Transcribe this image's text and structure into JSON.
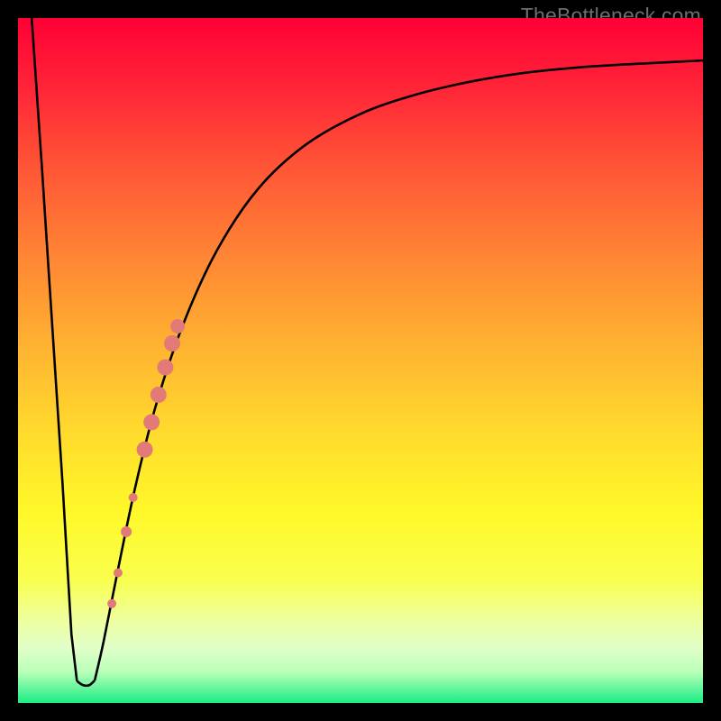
{
  "watermark": {
    "text": "TheBottleneck.com"
  },
  "colors": {
    "frame": "#000000",
    "curve": "#000000",
    "marker": "#e27b78",
    "marker_stroke": "#bb5a52"
  },
  "chart_data": {
    "type": "line",
    "title": "",
    "xlabel": "",
    "ylabel": "",
    "xlim": [
      0,
      100
    ],
    "ylim": [
      0,
      100
    ],
    "gradient_stops": [
      {
        "offset": 0.0,
        "color": "#ff0036"
      },
      {
        "offset": 0.1,
        "color": "#ff2437"
      },
      {
        "offset": 0.22,
        "color": "#ff5636"
      },
      {
        "offset": 0.35,
        "color": "#ff8634"
      },
      {
        "offset": 0.48,
        "color": "#ffb331"
      },
      {
        "offset": 0.6,
        "color": "#ffd92d"
      },
      {
        "offset": 0.72,
        "color": "#fff829"
      },
      {
        "offset": 0.82,
        "color": "#f9ff4e"
      },
      {
        "offset": 0.88,
        "color": "#eeffa0"
      },
      {
        "offset": 0.92,
        "color": "#e1ffc8"
      },
      {
        "offset": 0.955,
        "color": "#b8ffb8"
      },
      {
        "offset": 0.975,
        "color": "#72f7a1"
      },
      {
        "offset": 1.0,
        "color": "#19ec85"
      }
    ],
    "curve_left": {
      "x": [
        2.0,
        3.5,
        5.0,
        6.5,
        7.8,
        8.6
      ],
      "y": [
        100,
        78,
        55,
        32,
        10,
        3.2
      ]
    },
    "curve_floor": {
      "x": [
        8.6,
        9.5,
        10.4,
        11.2
      ],
      "y": [
        3.2,
        2.6,
        2.6,
        3.3
      ]
    },
    "curve_right": {
      "x": [
        11.2,
        12.5,
        14.5,
        17.0,
        20.0,
        24.0,
        29.0,
        35.0,
        42.0,
        50.0,
        58.0,
        66.0,
        74.0,
        82.0,
        90.0,
        100.0
      ],
      "y": [
        3.3,
        9.0,
        19.0,
        31.0,
        43.0,
        55.0,
        66.0,
        75.0,
        81.5,
        86.0,
        88.8,
        90.7,
        92.0,
        92.8,
        93.3,
        93.8
      ]
    },
    "markers": [
      {
        "x": 13.7,
        "y": 14.5,
        "r": 5
      },
      {
        "x": 14.6,
        "y": 19.0,
        "r": 5
      },
      {
        "x": 15.8,
        "y": 25.0,
        "r": 6
      },
      {
        "x": 16.8,
        "y": 30.0,
        "r": 5
      },
      {
        "x": 18.5,
        "y": 37.0,
        "r": 9
      },
      {
        "x": 19.5,
        "y": 41.0,
        "r": 9
      },
      {
        "x": 20.5,
        "y": 45.0,
        "r": 9
      },
      {
        "x": 21.5,
        "y": 49.0,
        "r": 9
      },
      {
        "x": 22.5,
        "y": 52.5,
        "r": 9
      },
      {
        "x": 23.3,
        "y": 55.0,
        "r": 8
      }
    ]
  }
}
